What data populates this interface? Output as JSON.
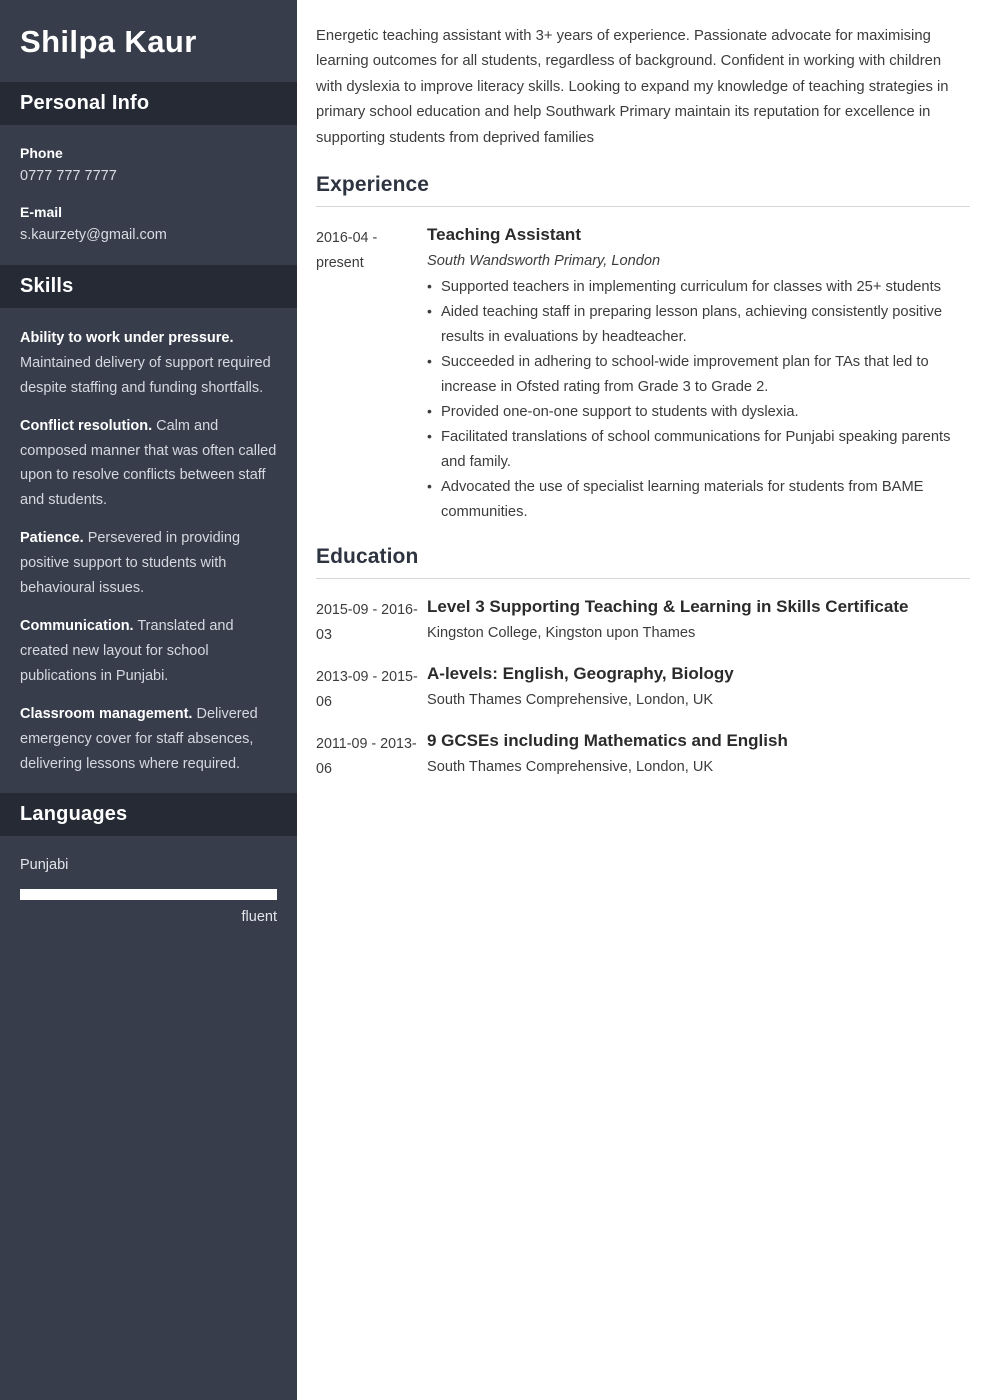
{
  "sidebar": {
    "name": "Shilpa Kaur",
    "personal_info": {
      "heading": "Personal Info",
      "items": [
        {
          "label": "Phone",
          "value": "0777 777 7777"
        },
        {
          "label": "E-mail",
          "value": "s.kaurzety@gmail.com"
        }
      ]
    },
    "skills": {
      "heading": "Skills",
      "items": [
        {
          "name": "Ability to work under pressure.",
          "description": " Maintained delivery of support required despite staffing and funding shortfalls."
        },
        {
          "name": "Conflict resolution.",
          "description": " Calm and composed manner that was often called upon to resolve conflicts between staff and students."
        },
        {
          "name": "Patience.",
          "description": " Persevered in providing positive support to students with behavioural issues."
        },
        {
          "name": "Communication.",
          "description": " Translated and created new layout for school publications in Punjabi."
        },
        {
          "name": "Classroom management.",
          "description": " Delivered emergency cover for staff absences, delivering lessons where required."
        }
      ]
    },
    "languages": {
      "heading": "Languages",
      "items": [
        {
          "name": "Punjabi",
          "level_label": "fluent",
          "level_percent": 100
        }
      ]
    },
    "colors": {
      "body_bg": "#373d4b",
      "header_band_bg": "#252a35",
      "text": "#ffffff",
      "muted_text": "#d4d8df",
      "bar_fill": "#ffffff"
    }
  },
  "main": {
    "summary": "Energetic teaching assistant with 3+ years of experience. Passionate advocate for maximising learning outcomes for all students, regardless of background. Confident in working with children with dyslexia to improve literacy skills. Looking to expand my knowledge of teaching strategies in primary school education and help Southwark Primary maintain its reputation for excellence in supporting students from deprived families",
    "experience": {
      "heading": "Experience",
      "entries": [
        {
          "date": "2016-04 - present",
          "title": "Teaching Assistant",
          "organisation": "South Wandsworth Primary, London",
          "bullets": [
            "Supported teachers in implementing curriculum for classes with 25+ students",
            "Aided teaching staff in preparing lesson plans, achieving consistently positive results in evaluations by headteacher.",
            "Succeeded in adhering to school-wide improvement plan for TAs that led to increase in Ofsted rating from Grade 3 to Grade 2.",
            "Provided one-on-one support to students with dyslexia.",
            "Facilitated translations of school communications for Punjabi speaking parents and family.",
            "Advocated the use of specialist learning materials for students from BAME communities."
          ]
        }
      ]
    },
    "education": {
      "heading": "Education",
      "entries": [
        {
          "date": "2015-09 - 2016-03",
          "title": "Level 3 Supporting Teaching & Learning in Skills Certificate",
          "organisation": "Kingston College, Kingston upon Thames"
        },
        {
          "date": "2013-09 - 2015-06",
          "title": "A-levels: English, Geography, Biology",
          "organisation": "South Thames Comprehensive, London, UK"
        },
        {
          "date": "2011-09 - 2013-06",
          "title": "9 GCSEs including Mathematics and English",
          "organisation": "South Thames Comprehensive, London, UK"
        }
      ]
    },
    "colors": {
      "page_bg": "#ffffff",
      "heading": "#2e3440",
      "text": "#3c3c3c",
      "rule": "#d7d7d7"
    }
  }
}
